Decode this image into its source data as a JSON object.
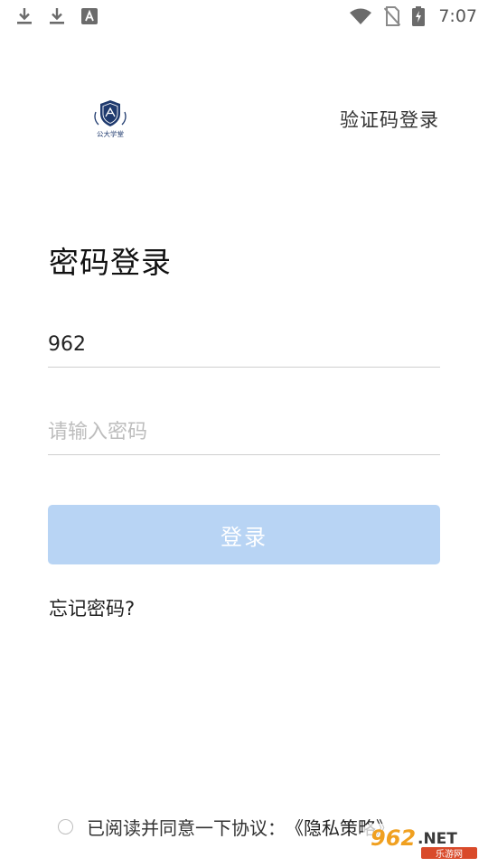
{
  "status_bar": {
    "time": "7:07",
    "left_icons": [
      "download-icon",
      "download-icon",
      "app-a-icon"
    ],
    "right_icons": [
      "wifi-icon",
      "no-sim-icon",
      "battery-charging-icon"
    ]
  },
  "header": {
    "logo_caption": "公大学堂",
    "switch_login_label": "验证码登录"
  },
  "title": "密码登录",
  "form": {
    "account_value": "962",
    "password_placeholder": "请输入密码",
    "login_button": "登录",
    "forgot_password": "忘记密码?"
  },
  "agreement": {
    "text": "已阅读并同意一下协议：",
    "link": "《隐私策略》"
  },
  "watermark": {
    "brand": "962.NET",
    "sub": "乐游网"
  },
  "colors": {
    "login_button_bg": "#b8d4f4",
    "logo_navy": "#1f3a6e"
  }
}
